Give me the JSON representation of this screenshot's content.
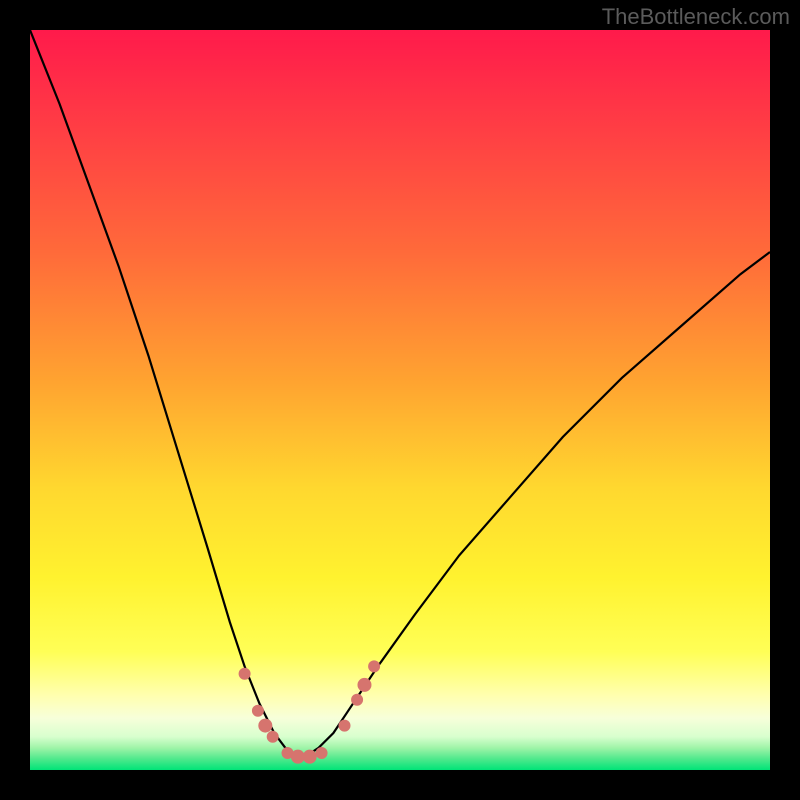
{
  "watermark": "TheBottleneck.com",
  "chart_data": {
    "type": "line",
    "title": "",
    "xlabel": "",
    "ylabel": "",
    "xlim": [
      0,
      100
    ],
    "ylim": [
      0,
      100
    ],
    "grid": false,
    "legend": false,
    "background_gradient": {
      "top_color": "#ff1a4b",
      "mid_colors": [
        "#ff6a3a",
        "#ffb52e",
        "#fff22f",
        "#ffff78"
      ],
      "bottom_color": "#00e478"
    },
    "series": [
      {
        "name": "bottleneck-curve",
        "color": "#000000",
        "x": [
          0,
          4,
          8,
          12,
          16,
          20,
          24,
          27,
          29,
          31,
          33,
          34.5,
          36,
          37.5,
          39,
          41,
          43,
          47,
          52,
          58,
          65,
          72,
          80,
          88,
          96,
          100
        ],
        "y": [
          100,
          90,
          79,
          68,
          56,
          43,
          30,
          20,
          14,
          9,
          5,
          3,
          2,
          2,
          3,
          5,
          8,
          14,
          21,
          29,
          37,
          45,
          53,
          60,
          67,
          70
        ]
      }
    ],
    "markers": {
      "name": "curve-marker",
      "color": "#d6746e",
      "points": [
        {
          "x": 29.0,
          "y": 13.0,
          "r": 6
        },
        {
          "x": 30.8,
          "y": 8.0,
          "r": 6
        },
        {
          "x": 31.8,
          "y": 6.0,
          "r": 7
        },
        {
          "x": 32.8,
          "y": 4.5,
          "r": 6
        },
        {
          "x": 34.8,
          "y": 2.3,
          "r": 6
        },
        {
          "x": 36.2,
          "y": 1.8,
          "r": 7
        },
        {
          "x": 37.8,
          "y": 1.8,
          "r": 7
        },
        {
          "x": 39.4,
          "y": 2.3,
          "r": 6
        },
        {
          "x": 42.5,
          "y": 6.0,
          "r": 6
        },
        {
          "x": 44.2,
          "y": 9.5,
          "r": 6
        },
        {
          "x": 45.2,
          "y": 11.5,
          "r": 7
        },
        {
          "x": 46.5,
          "y": 14.0,
          "r": 6
        }
      ]
    }
  }
}
